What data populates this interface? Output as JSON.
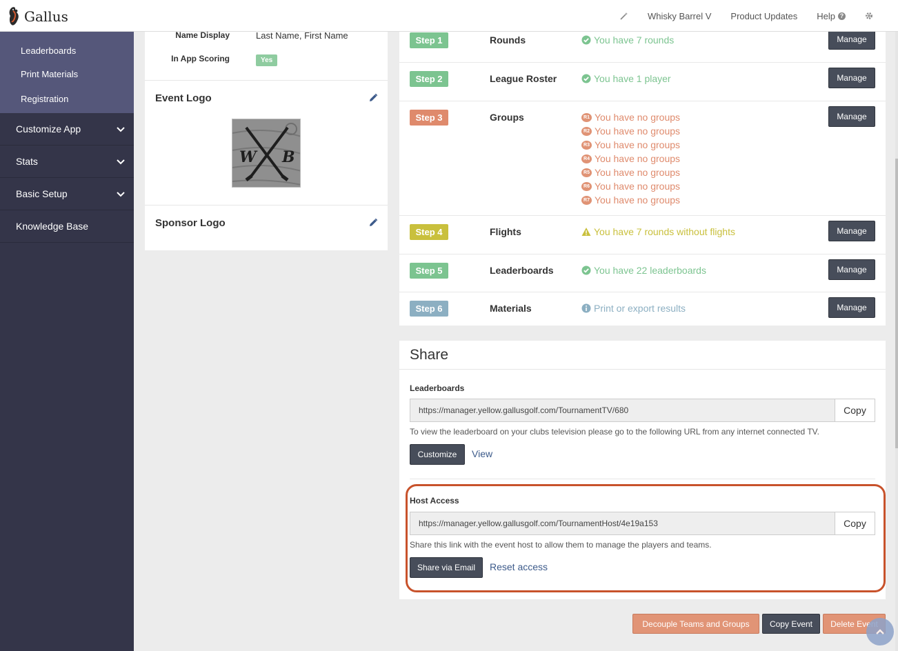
{
  "header": {
    "brand": "Gallus",
    "nav": [
      {
        "label": "Whisky Barrel V"
      },
      {
        "label": "Product Updates"
      },
      {
        "label": "Help"
      }
    ]
  },
  "sidebar": {
    "sub_items": [
      "Leaderboards",
      "Print Materials",
      "Registration"
    ],
    "items": [
      "Customize App",
      "Stats",
      "Basic Setup",
      "Knowledge Base"
    ]
  },
  "event_settings": {
    "name_display_label": "Name Display",
    "name_display_value": "Last Name, First Name",
    "in_app_scoring_label": "In App Scoring",
    "in_app_scoring_value": "Yes",
    "event_logo_title": "Event Logo",
    "event_logo_initials": [
      "W",
      "B"
    ],
    "sponsor_logo_title": "Sponsor Logo"
  },
  "steps": {
    "manage_label": "Manage",
    "items": [
      {
        "badge": "Step 1",
        "name": "Rounds",
        "status": [
          "You have 7 rounds"
        ],
        "kind": "ok"
      },
      {
        "badge": "Step 2",
        "name": "League Roster",
        "status": [
          "You have 1 player"
        ],
        "kind": "ok"
      },
      {
        "badge": "Step 3",
        "name": "Groups",
        "status": [
          "You have no groups",
          "You have no groups",
          "You have no groups",
          "You have no groups",
          "You have no groups",
          "You have no groups",
          "You have no groups"
        ],
        "round_badges": [
          "R1",
          "R2",
          "R3",
          "R4",
          "R5",
          "R6",
          "R7"
        ],
        "kind": "error"
      },
      {
        "badge": "Step 4",
        "name": "Flights",
        "status": [
          "You have 7 rounds without flights"
        ],
        "kind": "warn"
      },
      {
        "badge": "Step 5",
        "name": "Leaderboards",
        "status": [
          "You have 22 leaderboards"
        ],
        "kind": "ok"
      },
      {
        "badge": "Step 6",
        "name": "Materials",
        "status": [
          "Print or export results"
        ],
        "kind": "info"
      }
    ]
  },
  "share": {
    "title": "Share",
    "leaderboards_label": "Leaderboards",
    "leaderboards_url": "https://manager.yellow.gallusgolf.com/TournamentTV/680",
    "copy_label": "Copy",
    "leaderboards_help": "To view the leaderboard on your clubs television please go to the following URL from any internet connected TV.",
    "customize_label": "Customize",
    "view_label": "View",
    "host_label": "Host Access",
    "host_url": "https://manager.yellow.gallusgolf.com/TournamentHost/4e19a153",
    "host_help": "Share this link with the event host to allow them to manage the players and teams.",
    "share_email_label": "Share via Email",
    "reset_label": "Reset access"
  },
  "actions": {
    "decouple_label": "Decouple Teams and Groups",
    "copy_event_label": "Copy Event",
    "delete_event_label": "Delete Event"
  },
  "colors": {
    "ok": "#7cc490",
    "error": "#df8a6c",
    "warn": "#c9c03d",
    "info": "#8cafc2",
    "accent_dark": "#474d5a",
    "highlight": "#c8522b"
  }
}
